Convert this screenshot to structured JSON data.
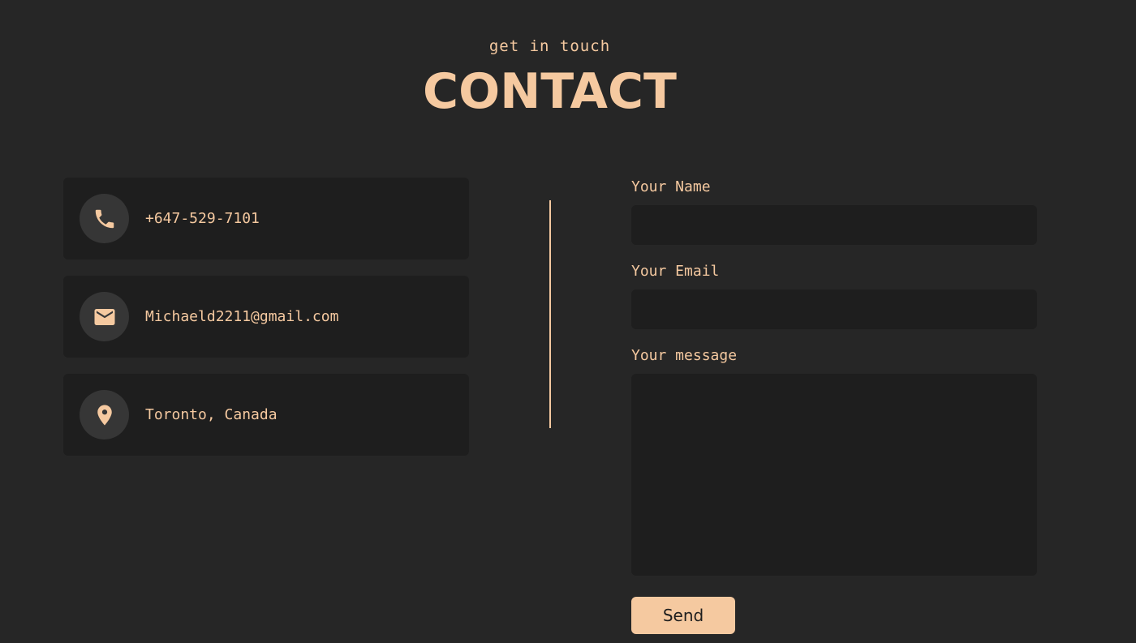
{
  "header": {
    "subtitle": "get in touch",
    "title": "CONTACT"
  },
  "contact_info": {
    "phone": {
      "icon": "phone-icon",
      "text": "+647-529-7101"
    },
    "email": {
      "icon": "mail-icon",
      "text": "Michaeld2211@gmail.com"
    },
    "location": {
      "icon": "location-pin-icon",
      "text": "Toronto, Canada"
    }
  },
  "form": {
    "name_label": "Your Name",
    "name_value": "",
    "email_label": "Your Email",
    "email_value": "",
    "message_label": "Your message",
    "message_value": "",
    "send_label": "Send"
  },
  "colors": {
    "background": "#262626",
    "card": "#1e1e1e",
    "icon_circle": "#363636",
    "accent": "#f5c9a0"
  }
}
